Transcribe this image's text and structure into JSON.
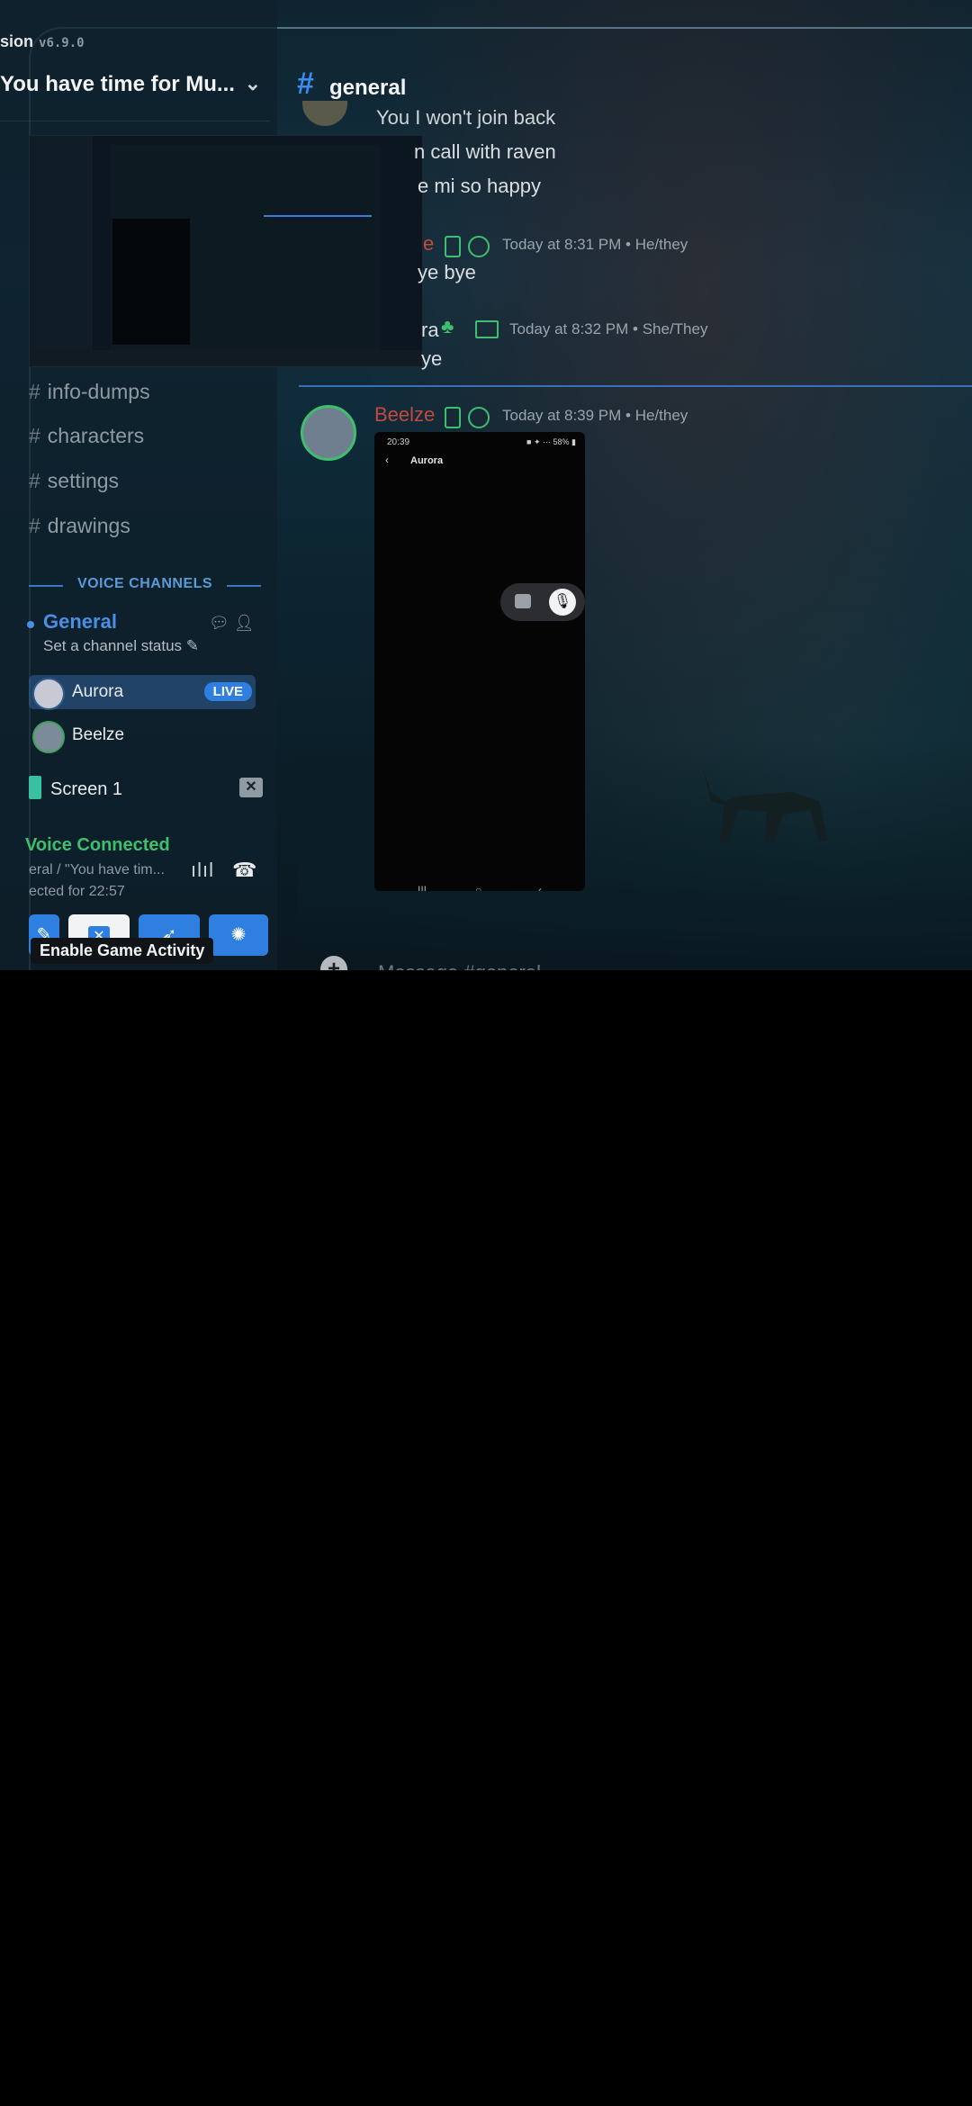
{
  "app": {
    "version_label": "sion",
    "version_number": "v6.9.0"
  },
  "server": {
    "name": "You have time for Mu..."
  },
  "channel_header": {
    "name": "general"
  },
  "text_channels": [
    {
      "name": "info-dumps"
    },
    {
      "name": "characters"
    },
    {
      "name": "settings"
    },
    {
      "name": "drawings"
    }
  ],
  "voice": {
    "header": "VOICE CHANNELS",
    "channel_name": "General",
    "channel_status": "Set a channel status",
    "users": [
      {
        "name": "Aurora",
        "badge": "LIVE"
      },
      {
        "name": "Beelze",
        "badge": ""
      }
    ],
    "screen_label": "Screen 1",
    "connected_label": "Voice Connected",
    "connected_path": "eral / \"You have tim...",
    "connected_time": "ected for 22:57"
  },
  "tooltip": "Enable Game Activity",
  "messages": {
    "line1": "You I won't join back",
    "line2": "n call with raven",
    "line3": "e mi so happy",
    "group2_author": "e",
    "group2_meta": "Today at 8:31 PM • He/they",
    "group2_text": "ye bye",
    "group3_author": "ra",
    "group3_meta": "Today at 8:32 PM • She/They",
    "group3_text": "ye",
    "group4_author": "Beelze",
    "group4_meta": "Today at 8:39 PM • He/they"
  },
  "phone_screenshot": {
    "time": "20:39",
    "status_right": "■ ✦ ⋯ 58% ▮",
    "back": "‹",
    "title": "Aurora",
    "nav_recent": "III",
    "nav_home": "○",
    "nav_back": "‹"
  },
  "composer": {
    "placeholder": "Message #general"
  },
  "colors": {
    "accent": "#2f7fe0",
    "connected_green": "#3fbf6e",
    "author_red": "#c04a3e"
  }
}
